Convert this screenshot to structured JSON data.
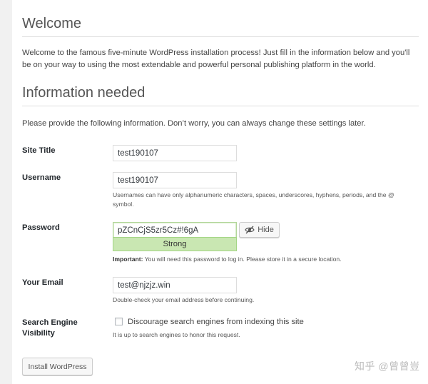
{
  "welcome": {
    "title": "Welcome",
    "text": "Welcome to the famous five-minute WordPress installation process! Just fill in the information below and you'll be on your way to using the most extendable and powerful personal publishing platform in the world."
  },
  "info": {
    "title": "Information needed",
    "text": "Please provide the following information. Don’t worry, you can always change these settings later."
  },
  "form": {
    "site_title": {
      "label": "Site Title",
      "value": "test190107"
    },
    "username": {
      "label": "Username",
      "value": "test190107",
      "hint": "Usernames can have only alphanumeric characters, spaces, underscores, hyphens, periods, and the @ symbol."
    },
    "password": {
      "label": "Password",
      "value": "pZCnCjS5zr5Cz#!6gA",
      "strength": "Strong",
      "hide_label": "Hide",
      "hint_strong": "Important:",
      "hint_rest": " You will need this password to log in. Please store it in a secure location."
    },
    "email": {
      "label": "Your Email",
      "value": "test@njzjz.win",
      "hint": "Double-check your email address before continuing."
    },
    "visibility": {
      "label_line1": "Search Engine",
      "label_line2": "Visibility",
      "checkbox_label": "Discourage search engines from indexing this site",
      "checked": false,
      "hint": "It is up to search engines to honor this request."
    },
    "submit_label": "Install WordPress"
  },
  "watermark": "知乎 @曾曾豈",
  "colors": {
    "background": "#f1f1f1",
    "strength_fill": "#c9e7b2",
    "strength_border": "#a3d584"
  },
  "icons": {
    "hide": "eye-slash-icon"
  }
}
